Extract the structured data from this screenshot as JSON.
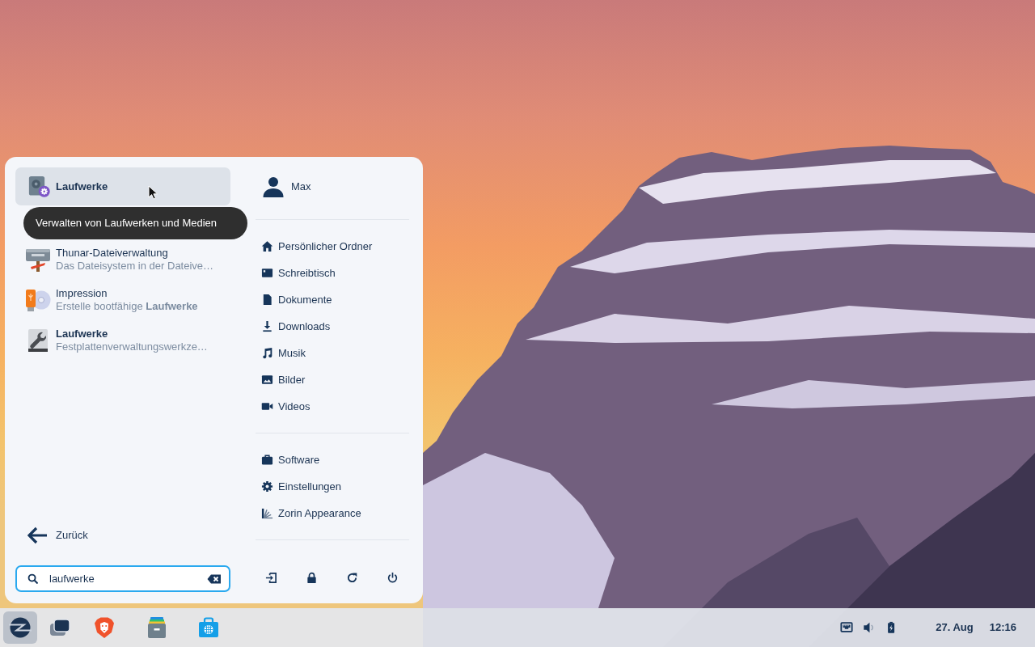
{
  "menu": {
    "top_result": {
      "title": "Laufwerke",
      "kind": "disk-settings",
      "selected": true
    },
    "tooltip": "Verwalten von Laufwerken und Medien",
    "results": [
      {
        "title": "Thunar-Dateiverwaltung",
        "matched": false,
        "description": "Das Dateisystem in der Dateive…",
        "kind": "file-manager"
      },
      {
        "title": "Impression",
        "matched": false,
        "description": "Erstelle bootfähige **Laufwerke**",
        "kind": "usb-disc"
      },
      {
        "title": "Laufwerke",
        "matched": true,
        "description": "Festplattenverwaltungswerkze…",
        "kind": "disk-tool"
      }
    ],
    "back_button": "Zurück",
    "search": {
      "value": "laufwerke"
    },
    "user": {
      "name": "Max"
    },
    "places": [
      {
        "label": "Persönlicher Ordner",
        "kind": "home"
      },
      {
        "label": "Schreibtisch",
        "kind": "desktop"
      },
      {
        "label": "Dokumente",
        "kind": "documents"
      },
      {
        "label": "Downloads",
        "kind": "downloads"
      },
      {
        "label": "Musik",
        "kind": "music"
      },
      {
        "label": "Bilder",
        "kind": "pictures"
      },
      {
        "label": "Videos",
        "kind": "videos"
      }
    ],
    "system": [
      {
        "label": "Software",
        "kind": "software"
      },
      {
        "label": "Einstellungen",
        "kind": "settings"
      },
      {
        "label": "Zorin Appearance",
        "kind": "appearance"
      }
    ],
    "session_buttons": [
      {
        "kind": "logout"
      },
      {
        "kind": "lock"
      },
      {
        "kind": "restart"
      },
      {
        "kind": "power"
      }
    ]
  },
  "taskbar": {
    "apps": [
      {
        "kind": "zorin",
        "selected": true
      },
      {
        "kind": "windows",
        "selected": false
      },
      {
        "kind": "browser",
        "selected": false
      },
      {
        "kind": "files",
        "selected": false
      },
      {
        "kind": "store",
        "selected": false
      }
    ],
    "tray": [
      {
        "kind": "network"
      },
      {
        "kind": "volume"
      },
      {
        "kind": "battery"
      }
    ],
    "date": "27. Aug",
    "time": "12:16"
  }
}
